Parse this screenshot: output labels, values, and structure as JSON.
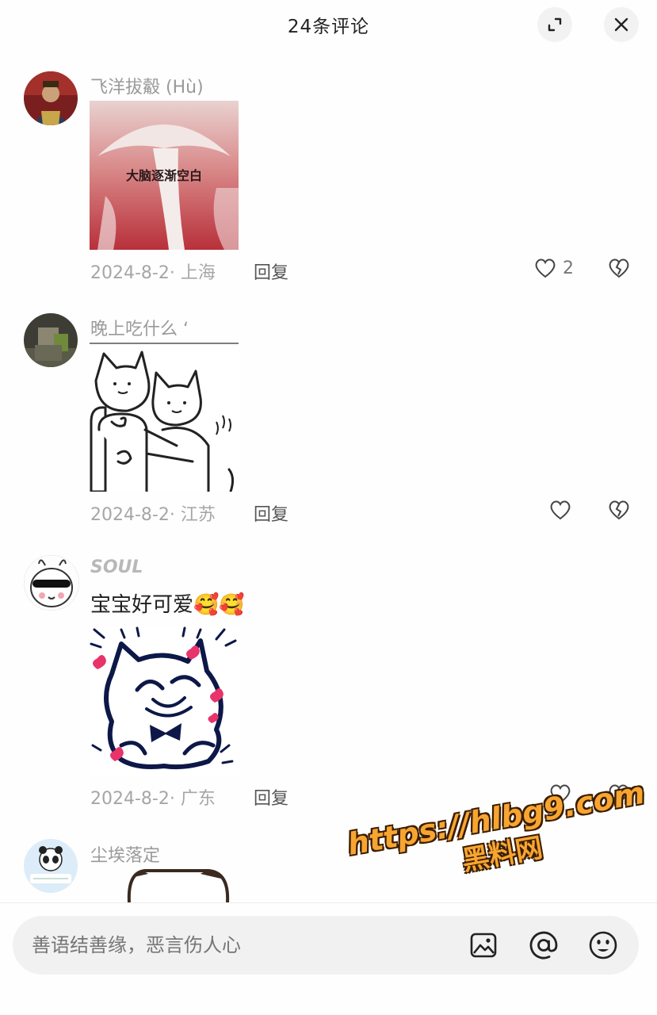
{
  "header": {
    "title": "24条评论"
  },
  "comments": [
    {
      "user": "飞洋拔觳 (Hù)",
      "text": "",
      "sticker_caption": "大脑逐渐空白",
      "date_location": "2024-8-2· 上海",
      "reply": "回复",
      "likes": "2"
    },
    {
      "user": "晚上吃什么 ʻ",
      "text": "",
      "date_location": "2024-8-2· 江苏",
      "reply": "回复",
      "likes": ""
    },
    {
      "user": "SOUL",
      "text": "宝宝好可爱🥰🥰",
      "date_location": "2024-8-2· 广东",
      "reply": "回复",
      "likes": ""
    },
    {
      "user": "尘埃落定",
      "text": ""
    }
  ],
  "input": {
    "placeholder": "善语结善缘，恶言伤人心"
  },
  "watermark": {
    "line1": "https://hlbg9.com",
    "line2": "黑料网"
  },
  "colors": {
    "accent_watermark": "#f7a531",
    "pink_heart": "#e8336b",
    "navy_sticker": "#0d1848"
  }
}
